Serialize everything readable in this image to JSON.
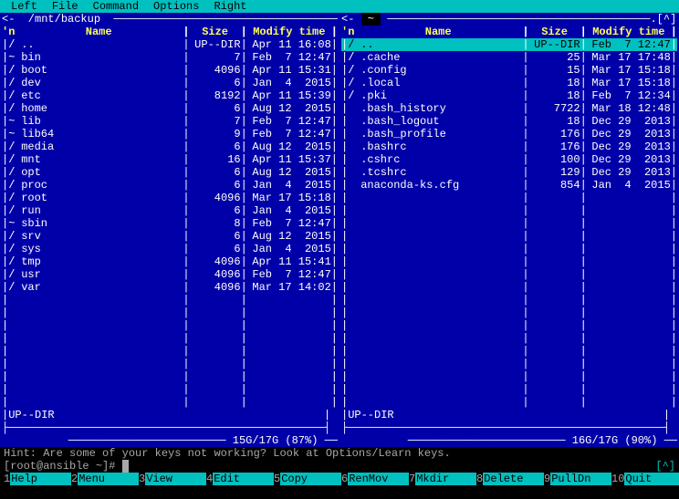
{
  "menubar": [
    "Left",
    "File",
    "Command",
    "Options",
    "Right"
  ],
  "panels": {
    "left": {
      "path": "/mnt/backup",
      "prefix": "<-",
      "suffix": ".[^]>",
      "active": false,
      "headers": {
        "mark": "'n",
        "name": "Name",
        "size": "Size",
        "modify": "Modify time"
      },
      "entries": [
        {
          "mark": "/",
          "name": "..",
          "size": "UP--DIR",
          "mod": "Apr 11 16:08",
          "sel": false
        },
        {
          "mark": "~",
          "name": "bin",
          "size": "7",
          "mod": "Feb  7 12:47",
          "sel": false
        },
        {
          "mark": "/",
          "name": "boot",
          "size": "4096",
          "mod": "Apr 11 15:31",
          "sel": false
        },
        {
          "mark": "/",
          "name": "dev",
          "size": "6",
          "mod": "Jan  4  2015",
          "sel": false
        },
        {
          "mark": "/",
          "name": "etc",
          "size": "8192",
          "mod": "Apr 11 15:39",
          "sel": false
        },
        {
          "mark": "/",
          "name": "home",
          "size": "6",
          "mod": "Aug 12  2015",
          "sel": false
        },
        {
          "mark": "~",
          "name": "lib",
          "size": "7",
          "mod": "Feb  7 12:47",
          "sel": false
        },
        {
          "mark": "~",
          "name": "lib64",
          "size": "9",
          "mod": "Feb  7 12:47",
          "sel": false
        },
        {
          "mark": "/",
          "name": "media",
          "size": "6",
          "mod": "Aug 12  2015",
          "sel": false
        },
        {
          "mark": "/",
          "name": "mnt",
          "size": "16",
          "mod": "Apr 11 15:37",
          "sel": false
        },
        {
          "mark": "/",
          "name": "opt",
          "size": "6",
          "mod": "Aug 12  2015",
          "sel": false
        },
        {
          "mark": "/",
          "name": "proc",
          "size": "6",
          "mod": "Jan  4  2015",
          "sel": false
        },
        {
          "mark": "/",
          "name": "root",
          "size": "4096",
          "mod": "Mar 17 15:18",
          "sel": false
        },
        {
          "mark": "/",
          "name": "run",
          "size": "6",
          "mod": "Jan  4  2015",
          "sel": false
        },
        {
          "mark": "~",
          "name": "sbin",
          "size": "8",
          "mod": "Feb  7 12:47",
          "sel": false
        },
        {
          "mark": "/",
          "name": "srv",
          "size": "6",
          "mod": "Aug 12  2015",
          "sel": false
        },
        {
          "mark": "/",
          "name": "sys",
          "size": "6",
          "mod": "Jan  4  2015",
          "sel": false
        },
        {
          "mark": "/",
          "name": "tmp",
          "size": "4096",
          "mod": "Apr 11 15:41",
          "sel": false
        },
        {
          "mark": "/",
          "name": "usr",
          "size": "4096",
          "mod": "Feb  7 12:47",
          "sel": false
        },
        {
          "mark": "/",
          "name": "var",
          "size": "4096",
          "mod": "Mar 17 14:02",
          "sel": false
        }
      ],
      "mini": "UP--DIR",
      "disk": "15G/17G (87%)"
    },
    "right": {
      "path": "~",
      "prefix": "<-",
      "suffix": ".[^]>",
      "active": true,
      "headers": {
        "mark": "'n",
        "name": "Name",
        "size": "Size",
        "modify": "Modify time"
      },
      "entries": [
        {
          "mark": "/",
          "name": "..",
          "size": "UP--DIR",
          "mod": "Feb  7 12:47",
          "sel": true
        },
        {
          "mark": "/",
          "name": ".cache",
          "size": "25",
          "mod": "Mar 17 17:48",
          "sel": false
        },
        {
          "mark": "/",
          "name": ".config",
          "size": "15",
          "mod": "Mar 17 15:18",
          "sel": false
        },
        {
          "mark": "/",
          "name": ".local",
          "size": "18",
          "mod": "Mar 17 15:18",
          "sel": false
        },
        {
          "mark": "/",
          "name": ".pki",
          "size": "18",
          "mod": "Feb  7 12:34",
          "sel": false
        },
        {
          "mark": " ",
          "name": ".bash_history",
          "size": "7722",
          "mod": "Mar 18 12:48",
          "sel": false
        },
        {
          "mark": " ",
          "name": ".bash_logout",
          "size": "18",
          "mod": "Dec 29  2013",
          "sel": false
        },
        {
          "mark": " ",
          "name": ".bash_profile",
          "size": "176",
          "mod": "Dec 29  2013",
          "sel": false
        },
        {
          "mark": " ",
          "name": ".bashrc",
          "size": "176",
          "mod": "Dec 29  2013",
          "sel": false
        },
        {
          "mark": " ",
          "name": ".cshrc",
          "size": "100",
          "mod": "Dec 29  2013",
          "sel": false
        },
        {
          "mark": " ",
          "name": ".tcshrc",
          "size": "129",
          "mod": "Dec 29  2013",
          "sel": false
        },
        {
          "mark": " ",
          "name": "anaconda-ks.cfg",
          "size": "854",
          "mod": "Jan  4  2015",
          "sel": false
        }
      ],
      "mini": "UP--DIR",
      "disk": "16G/17G (90%)"
    }
  },
  "hint": "Hint: Are some of your keys not working? Look at Options/Learn keys.",
  "prompt": "[root@ansible ~]# ",
  "bracket": "[^]",
  "fkeys": [
    {
      "n": "1",
      "l": "Help"
    },
    {
      "n": "2",
      "l": "Menu"
    },
    {
      "n": "3",
      "l": "View"
    },
    {
      "n": "4",
      "l": "Edit"
    },
    {
      "n": "5",
      "l": "Copy"
    },
    {
      "n": "6",
      "l": "RenMov"
    },
    {
      "n": "7",
      "l": "Mkdir"
    },
    {
      "n": "8",
      "l": "Delete"
    },
    {
      "n": "9",
      "l": "PullDn"
    },
    {
      "n": "10",
      "l": "Quit"
    }
  ]
}
